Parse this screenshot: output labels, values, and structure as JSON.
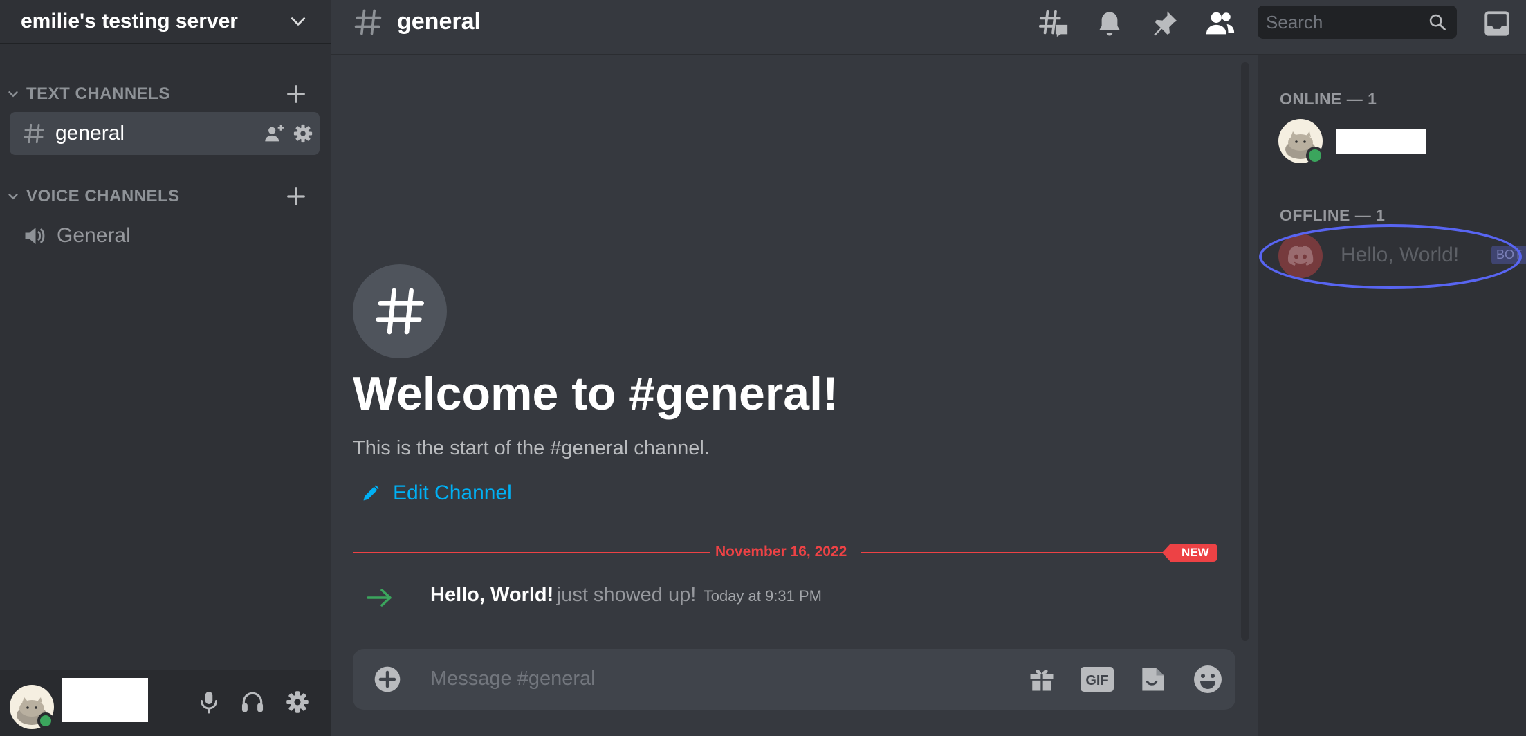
{
  "server": {
    "name": "emilie's testing server"
  },
  "sidebar": {
    "text_category": "TEXT CHANNELS",
    "voice_category": "VOICE CHANNELS",
    "text_channels": [
      {
        "label": "general",
        "active": true
      }
    ],
    "voice_channels": [
      {
        "label": "General"
      }
    ]
  },
  "header": {
    "channel_name": "general",
    "search_placeholder": "Search"
  },
  "welcome": {
    "title": "Welcome to #general!",
    "subtitle": "This is the start of the #general channel.",
    "edit_label": "Edit Channel"
  },
  "divider": {
    "date": "November 16, 2022",
    "badge": "NEW"
  },
  "message": {
    "user": "Hello, World!",
    "text": "just showed up!",
    "time": "Today at 9:31 PM"
  },
  "composer": {
    "placeholder": "Message #general",
    "gif_label": "GIF"
  },
  "members": {
    "online_header": "ONLINE — 1",
    "offline_header": "OFFLINE — 1",
    "offline": [
      {
        "name": "Hello, World!",
        "tag": "BOT"
      }
    ]
  },
  "colors": {
    "accent": "#5865f2",
    "online": "#3ba55d",
    "new_marker": "#ed4245",
    "link": "#00b0f4"
  }
}
